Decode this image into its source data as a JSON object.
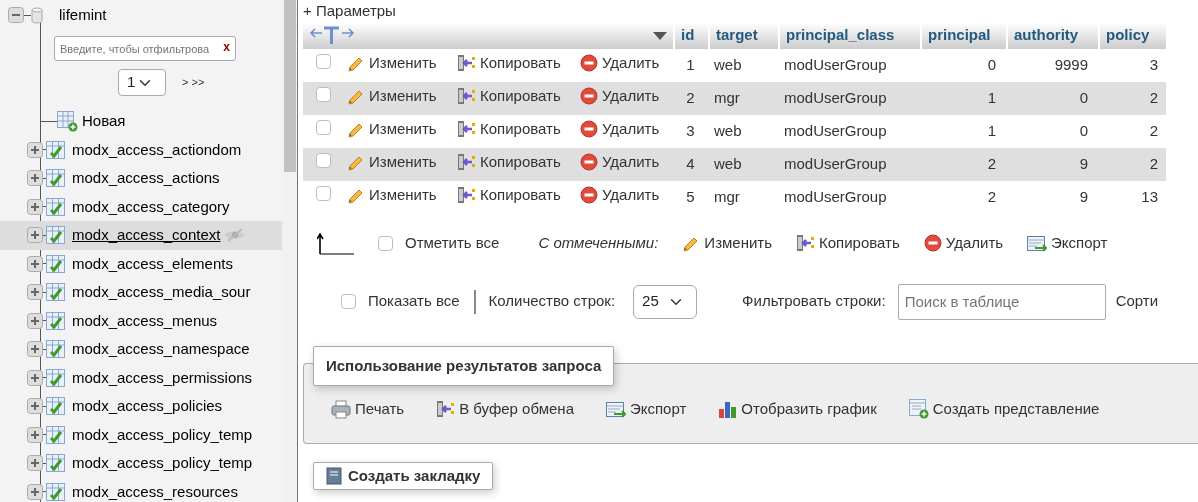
{
  "sidebar": {
    "database": {
      "name": "lifemint",
      "expanded": true
    },
    "filter": {
      "placeholder": "Введите, чтобы отфильтрова",
      "clear": "x"
    },
    "pager": {
      "page": "1",
      "next": "> >>"
    },
    "new_item": "Новая",
    "tables": [
      {
        "name": "modx_access_actiondom",
        "selected": false
      },
      {
        "name": "modx_access_actions",
        "selected": false
      },
      {
        "name": "modx_access_category",
        "selected": false
      },
      {
        "name": "modx_access_context",
        "selected": true
      },
      {
        "name": "modx_access_elements",
        "selected": false
      },
      {
        "name": "modx_access_media_sour",
        "selected": false
      },
      {
        "name": "modx_access_menus",
        "selected": false
      },
      {
        "name": "modx_access_namespace",
        "selected": false
      },
      {
        "name": "modx_access_permissions",
        "selected": false
      },
      {
        "name": "modx_access_policies",
        "selected": false
      },
      {
        "name": "modx_access_policy_temp",
        "selected": false
      },
      {
        "name": "modx_access_policy_temp",
        "selected": false
      },
      {
        "name": "modx_access_resources",
        "selected": false
      }
    ]
  },
  "options_link": "+ Параметры",
  "table": {
    "columns": [
      "id",
      "target",
      "principal_class",
      "principal",
      "authority",
      "policy"
    ],
    "rows": [
      {
        "checked": false,
        "actions": [
          {
            "kind": "edit",
            "label": "Изменить"
          },
          {
            "kind": "copy",
            "label": "Копировать"
          },
          {
            "kind": "delete",
            "label": "Удалить"
          }
        ],
        "cells": [
          "1",
          "web",
          "modUserGroup",
          "0",
          "9999",
          "3"
        ]
      },
      {
        "checked": false,
        "actions": [
          {
            "kind": "edit",
            "label": "Изменить"
          },
          {
            "kind": "copy",
            "label": "Копировать"
          },
          {
            "kind": "delete",
            "label": "Удалить"
          }
        ],
        "cells": [
          "2",
          "mgr",
          "modUserGroup",
          "1",
          "0",
          "2"
        ]
      },
      {
        "checked": false,
        "actions": [
          {
            "kind": "edit",
            "label": "Изменить"
          },
          {
            "kind": "copy",
            "label": "Копировать"
          },
          {
            "kind": "delete",
            "label": "Удалить"
          }
        ],
        "cells": [
          "3",
          "web",
          "modUserGroup",
          "1",
          "0",
          "2"
        ]
      },
      {
        "checked": false,
        "actions": [
          {
            "kind": "edit",
            "label": "Изменить"
          },
          {
            "kind": "copy",
            "label": "Копировать"
          },
          {
            "kind": "delete",
            "label": "Удалить"
          }
        ],
        "cells": [
          "4",
          "web",
          "modUserGroup",
          "2",
          "9",
          "2"
        ]
      },
      {
        "checked": false,
        "actions": [
          {
            "kind": "edit",
            "label": "Изменить"
          },
          {
            "kind": "copy",
            "label": "Копировать"
          },
          {
            "kind": "delete",
            "label": "Удалить"
          }
        ],
        "cells": [
          "5",
          "mgr",
          "modUserGroup",
          "2",
          "9",
          "13"
        ]
      }
    ]
  },
  "bulk": {
    "select_all": {
      "label": "Отметить все",
      "checked": false
    },
    "with_selected": "С отмеченными:",
    "actions": [
      {
        "kind": "edit",
        "label": "Изменить"
      },
      {
        "kind": "copy",
        "label": "Копировать"
      },
      {
        "kind": "delete",
        "label": "Удалить"
      },
      {
        "kind": "export",
        "label": "Экспорт"
      }
    ]
  },
  "display": {
    "show_all": {
      "label": "Показать все",
      "checked": false
    },
    "rows_label": "Количество строк:",
    "rows_value": "25",
    "filter_label": "Фильтровать строки:",
    "filter_placeholder": "Поиск в таблице",
    "sort_label": "Сорти"
  },
  "query_results": {
    "legend": "Использование результатов запроса",
    "actions": [
      {
        "kind": "print",
        "label": "Печать"
      },
      {
        "kind": "copy",
        "label": "В буфер обмена"
      },
      {
        "kind": "export",
        "label": "Экспорт"
      },
      {
        "kind": "chart",
        "label": "Отобразить график"
      },
      {
        "kind": "view",
        "label": "Создать представление"
      }
    ]
  },
  "bookmark": {
    "legend": "Создать закладку"
  }
}
